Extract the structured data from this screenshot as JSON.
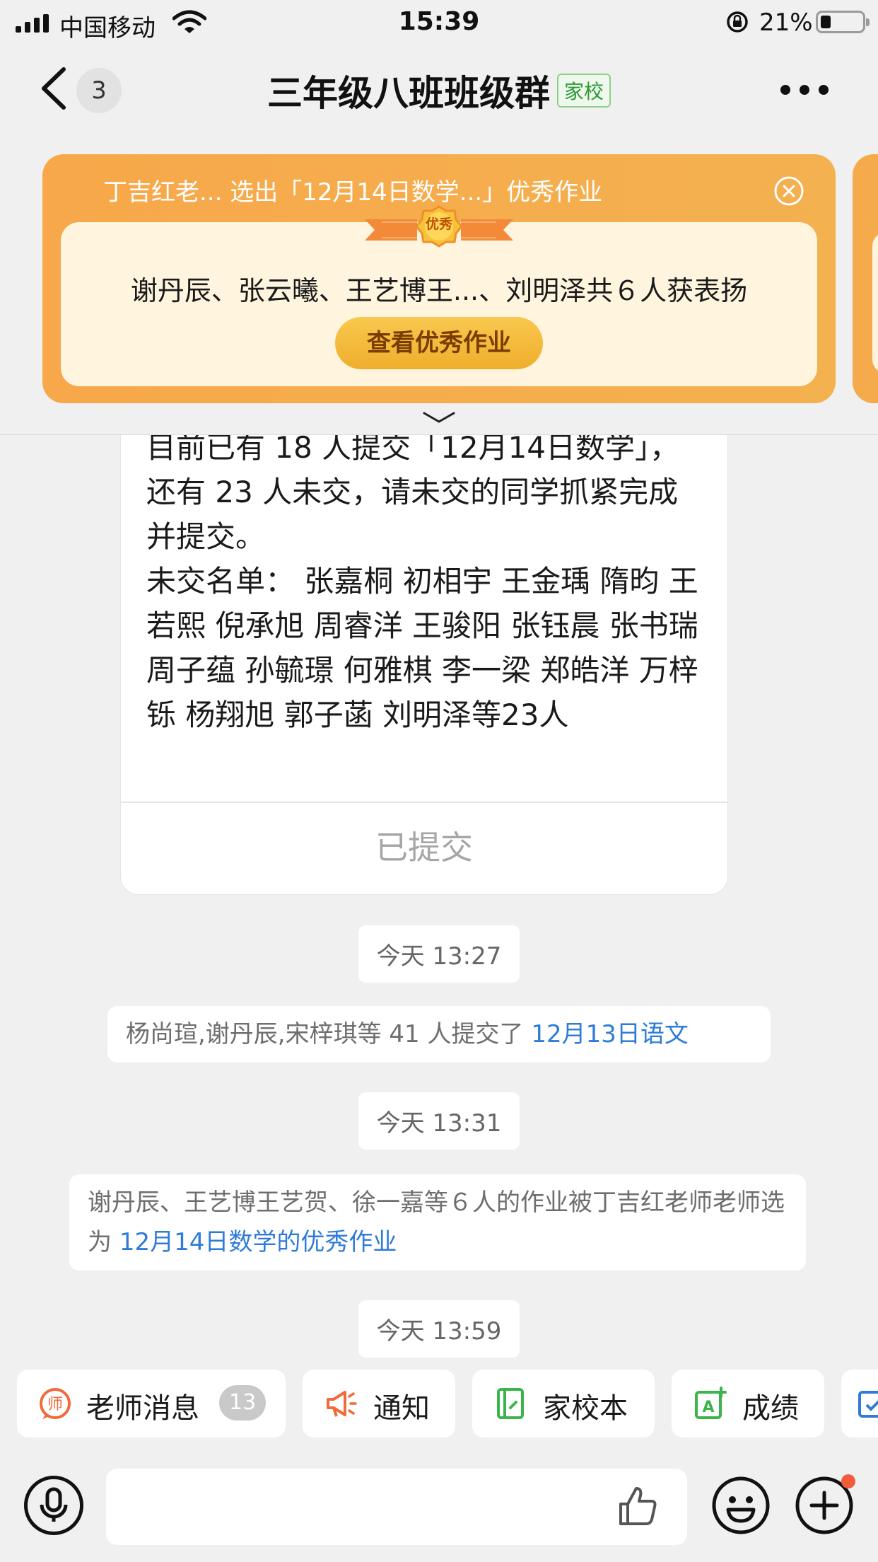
{
  "status_bar": {
    "carrier": "中国移动",
    "time": "15:39",
    "battery_percent": "21%",
    "battery_level": 0.21
  },
  "nav": {
    "unread_count": "3",
    "title": "三年级八班班级群",
    "badge": "家校"
  },
  "banner": {
    "header": "丁吉红老... 选出「12月14日数学...」优秀作业",
    "ribbon_label": "优秀",
    "names": "谢丹辰、张云曦、王艺博王...、刘明泽共６人获表扬",
    "button": "查看优秀作业",
    "colors": {
      "primary": "#f7a84a",
      "card": "#fff5df",
      "button": "#efae2c"
    }
  },
  "message_bubble": {
    "text": "目前已有 18 人提交「12月14日数学」，还有 23 人未交，请未交的同学抓紧完成并提交。",
    "missing_label": "未交名单：",
    "missing_list": "  张嘉桐  初相宇  王金瑀  隋昀  王若熙  倪承旭  周睿洋  王骏阳  张钰晨  张书瑞  周子蕴  孙毓璟  何雅棋  李一梁  郑皓洋  万梓铄  杨翔旭  郭子菡  刘明泽等23人",
    "action": "已提交"
  },
  "timeline": [
    {
      "time": "今天 13:27"
    },
    {
      "time": "今天 13:31"
    },
    {
      "time": "今天 13:59"
    }
  ],
  "system_messages": [
    {
      "prefix": "杨尚瑄,谢丹辰,宋梓琪等 41 人提交了 ",
      "link": "12月13日语文"
    },
    {
      "prefix": "谢丹辰、王艺博王艺贺、徐一嘉等６人的作业被丁吉红老师老师选为 ",
      "link": "12月14日数学的优秀作业"
    }
  ],
  "quick_bar": {
    "teacher_msg": "老师消息",
    "teacher_count": "13",
    "notice": "通知",
    "home_school": "家校本",
    "grades": "成绩"
  },
  "colors": {
    "link": "#2f7bd8",
    "badge_green": "#2e9a37",
    "background": "#f0f0f0"
  }
}
